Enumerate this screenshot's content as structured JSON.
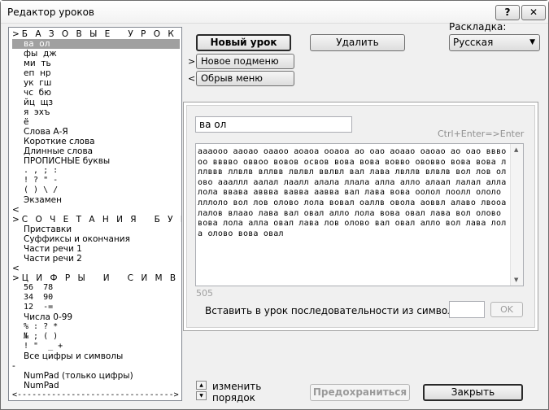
{
  "window": {
    "title": "Редактор уроков",
    "help_label": "?",
    "close_label": "✕"
  },
  "tree": {
    "rows": [
      {
        "text": ">Б А З О В Ы Е   У Р О К И",
        "kind": "head"
      },
      {
        "text": "ва  ол",
        "kind": "item",
        "selected": true
      },
      {
        "text": "фы  дж",
        "kind": "item"
      },
      {
        "text": "ми  ть",
        "kind": "item"
      },
      {
        "text": "еп  нр",
        "kind": "item"
      },
      {
        "text": "ук  гш",
        "kind": "item"
      },
      {
        "text": "чс  бю",
        "kind": "item"
      },
      {
        "text": "йц  щз",
        "kind": "item"
      },
      {
        "text": "я  эхъ",
        "kind": "item"
      },
      {
        "text": "ё",
        "kind": "item"
      },
      {
        "text": "Слова А-Я",
        "kind": "item"
      },
      {
        "text": "Короткие слова",
        "kind": "item"
      },
      {
        "text": "Длинные слова",
        "kind": "item"
      },
      {
        "text": "ПРОПИСНЫЕ буквы",
        "kind": "item"
      },
      {
        "text": ". , ; :",
        "kind": "item mono"
      },
      {
        "text": "! ? \" -",
        "kind": "item mono"
      },
      {
        "text": "( ) \\ /",
        "kind": "item mono"
      },
      {
        "text": "Экзамен",
        "kind": "item"
      },
      {
        "text": "<",
        "kind": "plain"
      },
      {
        "text": ">С О Ч Е Т А Н И Я   Б У К В",
        "kind": "head"
      },
      {
        "text": "Приставки",
        "kind": "item"
      },
      {
        "text": "Суффиксы и окончания",
        "kind": "item"
      },
      {
        "text": "Части речи 1",
        "kind": "item"
      },
      {
        "text": "Части речи 2",
        "kind": "item"
      },
      {
        "text": "<",
        "kind": "plain"
      },
      {
        "text": ">Ц И Ф Р Ы   И   С И М В О Л Ы",
        "kind": "head"
      },
      {
        "text": "56  78",
        "kind": "item mono"
      },
      {
        "text": "34  90",
        "kind": "item mono"
      },
      {
        "text": "12  -=",
        "kind": "item mono"
      },
      {
        "text": "Числа 0-99",
        "kind": "item"
      },
      {
        "text": "% : ? *",
        "kind": "item mono"
      },
      {
        "text": "№ ; ( )",
        "kind": "item mono"
      },
      {
        "text": "! \"  _ +",
        "kind": "item mono"
      },
      {
        "text": "Все цифры и символы",
        "kind": "item"
      },
      {
        "text": "-",
        "kind": "plain"
      },
      {
        "text": "NumPad (только цифры)",
        "kind": "item"
      },
      {
        "text": "NumPad",
        "kind": "item"
      },
      {
        "text": "<-------------------------------->",
        "kind": "plain mono"
      }
    ]
  },
  "actions": {
    "new_lesson": "Новый урок",
    "delete": "Удалить",
    "new_submenu_arrow": ">",
    "new_submenu": "Новое подменю",
    "break_menu_arrow": "<",
    "break_menu": "Обрыв меню"
  },
  "layout_selector": {
    "label": "Раскладка:",
    "value": "Русская"
  },
  "editor": {
    "lesson_name": "ва  ол",
    "hint": "Ctrl+Enter=>Enter",
    "content": "аааооо ааоао оааоо аоаоа ооаоа ао оао аоаао оаоао ао оао вввооо вввво оввоо вовов освов вова вова вовво ововво вова вова лллввв ллвлв вллвв лвлвл ввлвл вал лава лвллв влвлв вол лов олово аааллл аалал лаалл алала ллала алла алло алаал лалал алла лола ввава аввва вавва аавва вал лава вова оолол лоолл ололо лллоло вол лов олово лола вовал оаллв овола аоввл алаво лвооа лалов влаао лава вал овал алло лола вова овал лава вол олово вова лола алла овал лава лов олово вал овал алло вол лава лола олово вова овал",
    "char_count": "505",
    "insert_label": "Вставить в урок последовательности из символов",
    "insert_value": "",
    "ok_label": "OK"
  },
  "footer": {
    "order_label": "изменить\nпорядок",
    "save_label": "Предохраниться",
    "close_label": "Закрыть"
  }
}
